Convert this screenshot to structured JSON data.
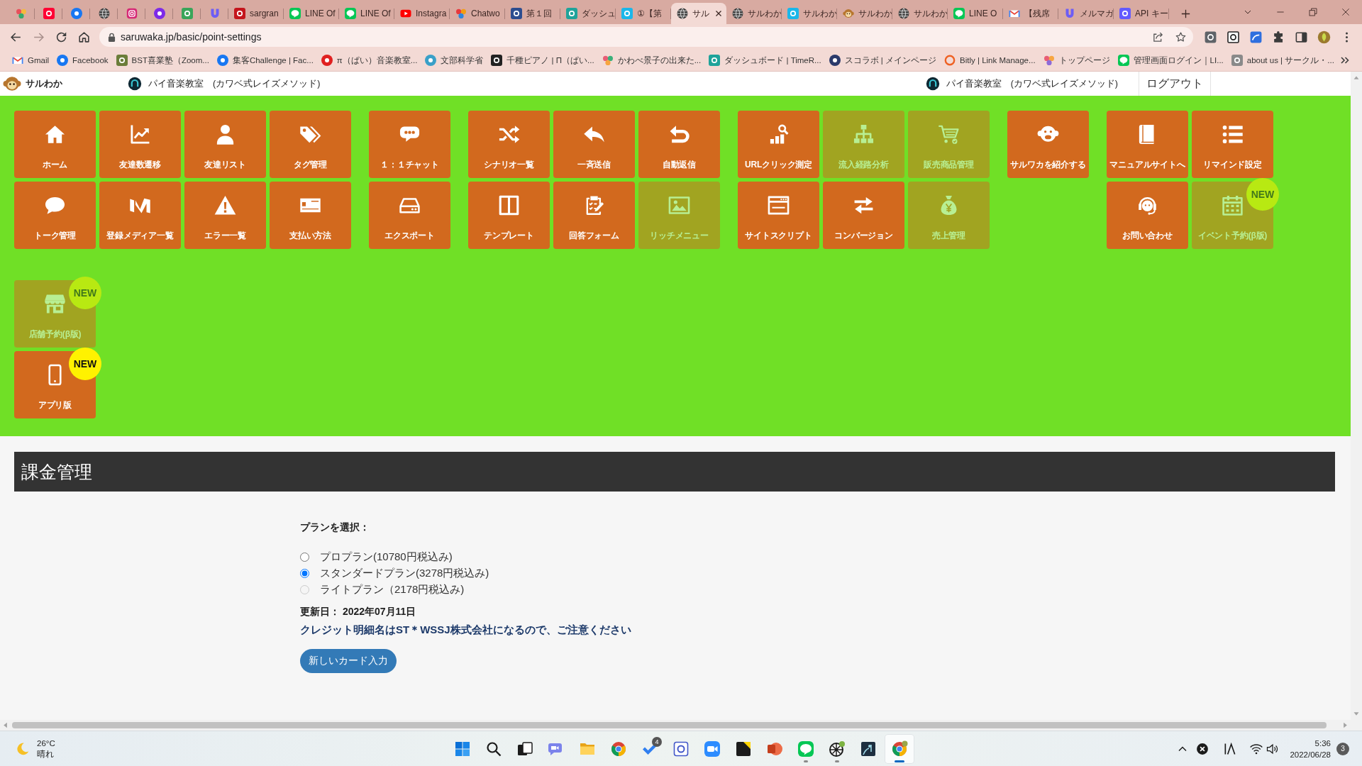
{
  "browser": {
    "tabs": [
      {
        "pinned": true,
        "selected": false
      },
      {
        "pinned": true,
        "selected": false
      },
      {
        "pinned": true,
        "selected": false
      },
      {
        "pinned": true,
        "selected": false
      },
      {
        "pinned": true,
        "selected": false
      },
      {
        "pinned": true,
        "selected": false
      },
      {
        "pinned": true,
        "selected": false
      },
      {
        "pinned": true,
        "selected": false
      },
      {
        "title": "sargran",
        "pinned": false,
        "selected": false
      },
      {
        "title": "LINE Of",
        "pinned": false,
        "selected": false
      },
      {
        "title": "LINE Of",
        "pinned": false,
        "selected": false
      },
      {
        "title": "Instagra",
        "pinned": false,
        "selected": false
      },
      {
        "title": "Chatwo",
        "pinned": false,
        "selected": false
      },
      {
        "title": "第１回",
        "pinned": false,
        "selected": false
      },
      {
        "title": "ダッシュ",
        "pinned": false,
        "selected": false
      },
      {
        "title": "①【第",
        "pinned": false,
        "selected": false
      },
      {
        "title": "サル",
        "pinned": false,
        "selected": true
      },
      {
        "title": "サルわか",
        "pinned": false,
        "selected": false
      },
      {
        "title": "サルわか",
        "pinned": false,
        "selected": false
      },
      {
        "title": "サルわか",
        "pinned": false,
        "selected": false
      },
      {
        "title": "サルわか",
        "pinned": false,
        "selected": false
      },
      {
        "title": "LINE O",
        "pinned": false,
        "selected": false
      },
      {
        "title": "【残席",
        "pinned": false,
        "selected": false
      },
      {
        "title": "メルマガ",
        "pinned": false,
        "selected": false
      },
      {
        "title": "API キー",
        "pinned": false,
        "selected": false
      }
    ],
    "address_bar": {
      "url": "saruwaka.jp/basic/point-settings"
    },
    "bookmarks": [
      {
        "label": "Gmail"
      },
      {
        "label": "Facebook"
      },
      {
        "label": "BST喜業塾（Zoom..."
      },
      {
        "label": "集客Challenge | Fac..."
      },
      {
        "label": "π（ぱい）音楽教室..."
      },
      {
        "label": "文部科学省"
      },
      {
        "label": "千種ピアノ | Π（ぱい..."
      },
      {
        "label": "かわべ景子の出来た..."
      },
      {
        "label": "ダッシュボード | TimeR..."
      },
      {
        "label": "スコラボ | メインページ"
      },
      {
        "label": "Bitly | Link Manage..."
      },
      {
        "label": "トップページ"
      },
      {
        "label": "管理画面ログイン｜LI..."
      },
      {
        "label": "about us | サークル・..."
      }
    ]
  },
  "page_header": {
    "logo": "サルわか",
    "account_left": "パイ音楽教室　(カワベ式レイズメソッド)",
    "account_right": "パイ音楽教室　(カワベ式レイズメソッド)",
    "logout": "ログアウト"
  },
  "menu": {
    "groups": [
      {
        "rows": [
          [
            {
              "label": "ホーム",
              "disabled": false
            },
            {
              "label": "友達数遷移",
              "disabled": false
            },
            {
              "label": "友達リスト",
              "disabled": false
            },
            {
              "label": "タグ管理",
              "disabled": false
            }
          ],
          [
            {
              "label": "トーク管理",
              "disabled": false
            },
            {
              "label": "登録メディア一覧",
              "disabled": false
            },
            {
              "label": "エラー一覧",
              "disabled": false
            },
            {
              "label": "支払い方法",
              "disabled": false
            }
          ]
        ]
      },
      {
        "rows": [
          [
            {
              "label": "１：１チャット",
              "disabled": false
            }
          ],
          [
            {
              "label": "エクスポート",
              "disabled": false
            }
          ]
        ]
      },
      {
        "rows": [
          [
            {
              "label": "シナリオ一覧",
              "disabled": false
            },
            {
              "label": "一斉送信",
              "disabled": false
            },
            {
              "label": "自動返信",
              "disabled": false
            }
          ],
          [
            {
              "label": "テンプレート",
              "disabled": false
            },
            {
              "label": "回答フォーム",
              "disabled": false
            },
            {
              "label": "リッチメニュー",
              "disabled": true
            }
          ]
        ]
      },
      {
        "rows": [
          [
            {
              "label": "URLクリック測定",
              "disabled": false
            },
            {
              "label": "流入経路分析",
              "disabled": true
            },
            {
              "label": "販売商品管理",
              "disabled": true
            }
          ],
          [
            {
              "label": "サイトスクリプト",
              "disabled": false
            },
            {
              "label": "コンバージョン",
              "disabled": false
            },
            {
              "label": "売上管理",
              "disabled": true
            }
          ]
        ]
      },
      {
        "rows": [
          [
            {
              "label": "サルワカを紹介する",
              "disabled": false
            }
          ]
        ]
      },
      {
        "rows": [
          [
            {
              "label": "マニュアルサイトへ",
              "disabled": false
            },
            {
              "label": "リマインド設定",
              "disabled": false
            }
          ],
          [
            {
              "label": "お問い合わせ",
              "disabled": false
            },
            {
              "label": "イベント予約(β版)",
              "disabled": true,
              "badge": "NEW"
            }
          ]
        ]
      }
    ],
    "extra_tiles": [
      {
        "label": "店舗予約(β版)",
        "disabled": true,
        "badge": "NEW"
      },
      {
        "label": "アプリ版",
        "disabled": false,
        "badge": "NEW"
      }
    ]
  },
  "billing": {
    "title": "課金管理",
    "plan_prompt": "プランを選択：",
    "plans": [
      {
        "label": "プロプラン(10780円税込み)",
        "selected": false,
        "disabled": false
      },
      {
        "label": "スタンダードプラン(3278円税込み)",
        "selected": true,
        "disabled": false
      },
      {
        "label": "ライトプラン（2178円税込み)",
        "selected": false,
        "disabled": true
      }
    ],
    "updated": "更新日： 2022年07月11日",
    "notice": "クレジット明細名はST＊WSSJ株式会社になるので、ご注意ください",
    "new_card_button": "新しいカード入力"
  },
  "taskbar": {
    "weather": {
      "temperature": "26°C",
      "condition": "晴れ"
    },
    "apps": [
      {
        "running": false,
        "selected": false
      },
      {
        "running": false,
        "selected": false
      },
      {
        "running": false,
        "selected": false
      },
      {
        "running": false,
        "selected": false
      },
      {
        "running": false,
        "selected": false
      },
      {
        "running": false,
        "selected": false
      },
      {
        "running": false,
        "selected": false,
        "badge": "4"
      },
      {
        "running": false,
        "selected": false
      },
      {
        "running": false,
        "selected": false
      },
      {
        "running": false,
        "selected": false
      },
      {
        "running": false,
        "selected": false
      },
      {
        "running": true,
        "selected": false
      },
      {
        "running": true,
        "selected": false
      },
      {
        "running": false,
        "selected": false
      },
      {
        "running": true,
        "selected": true
      }
    ],
    "clock": {
      "time": "5:36",
      "date": "2022/06/28"
    },
    "notification_count": "3"
  }
}
